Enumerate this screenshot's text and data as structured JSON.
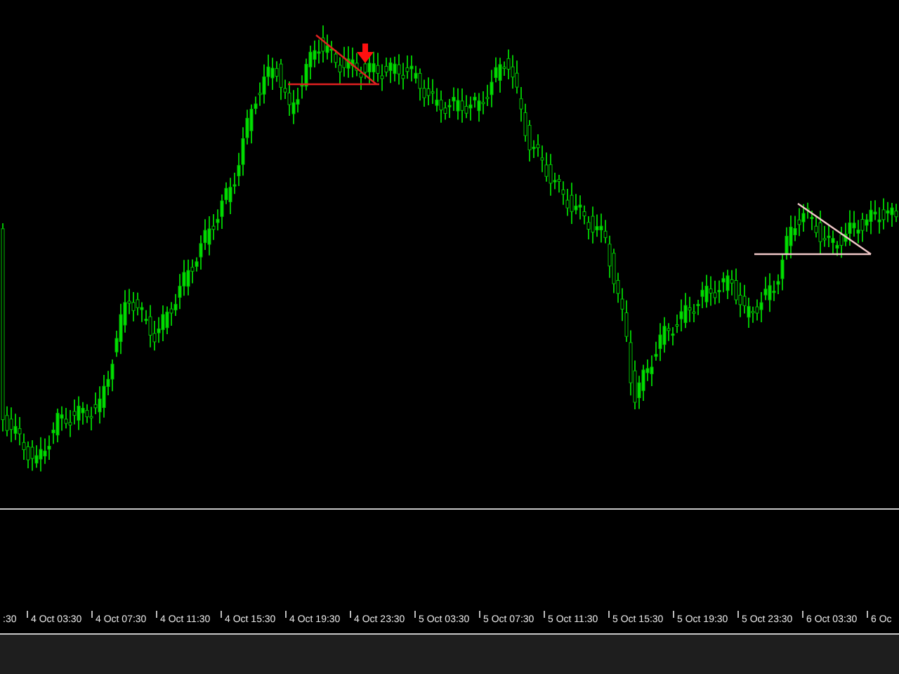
{
  "time_axis": {
    "labels": [
      ":30",
      "4 Oct 03:30",
      "4 Oct 07:30",
      "4 Oct 11:30",
      "4 Oct 15:30",
      "4 Oct 19:30",
      "4 Oct 23:30",
      "5 Oct 03:30",
      "5 Oct 07:30",
      "5 Oct 11:30",
      "5 Oct 15:30",
      "5 Oct 19:30",
      "5 Oct 23:30",
      "6 Oct 03:30",
      "6 Oc"
    ]
  }
}
